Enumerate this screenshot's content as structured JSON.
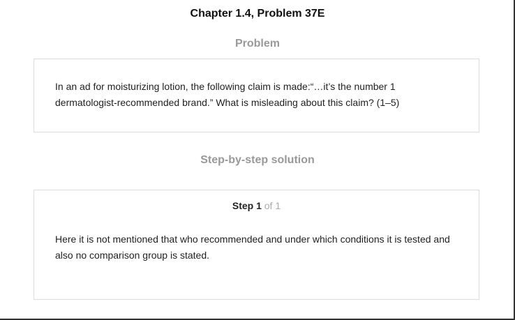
{
  "header": {
    "title": "Chapter 1.4, Problem 37E"
  },
  "problem": {
    "heading": "Problem",
    "text": "In an ad for moisturizing lotion, the following claim is made:“…it’s the number 1 dermatologist-recommended brand.” What is misleading about this claim? (1–5)"
  },
  "solution": {
    "heading": "Step-by-step solution",
    "step_word": "Step 1",
    "step_of": "of 1",
    "text": "Here it is not mentioned that who recommended and under which conditions it is tested and also no comparison group is stated."
  }
}
